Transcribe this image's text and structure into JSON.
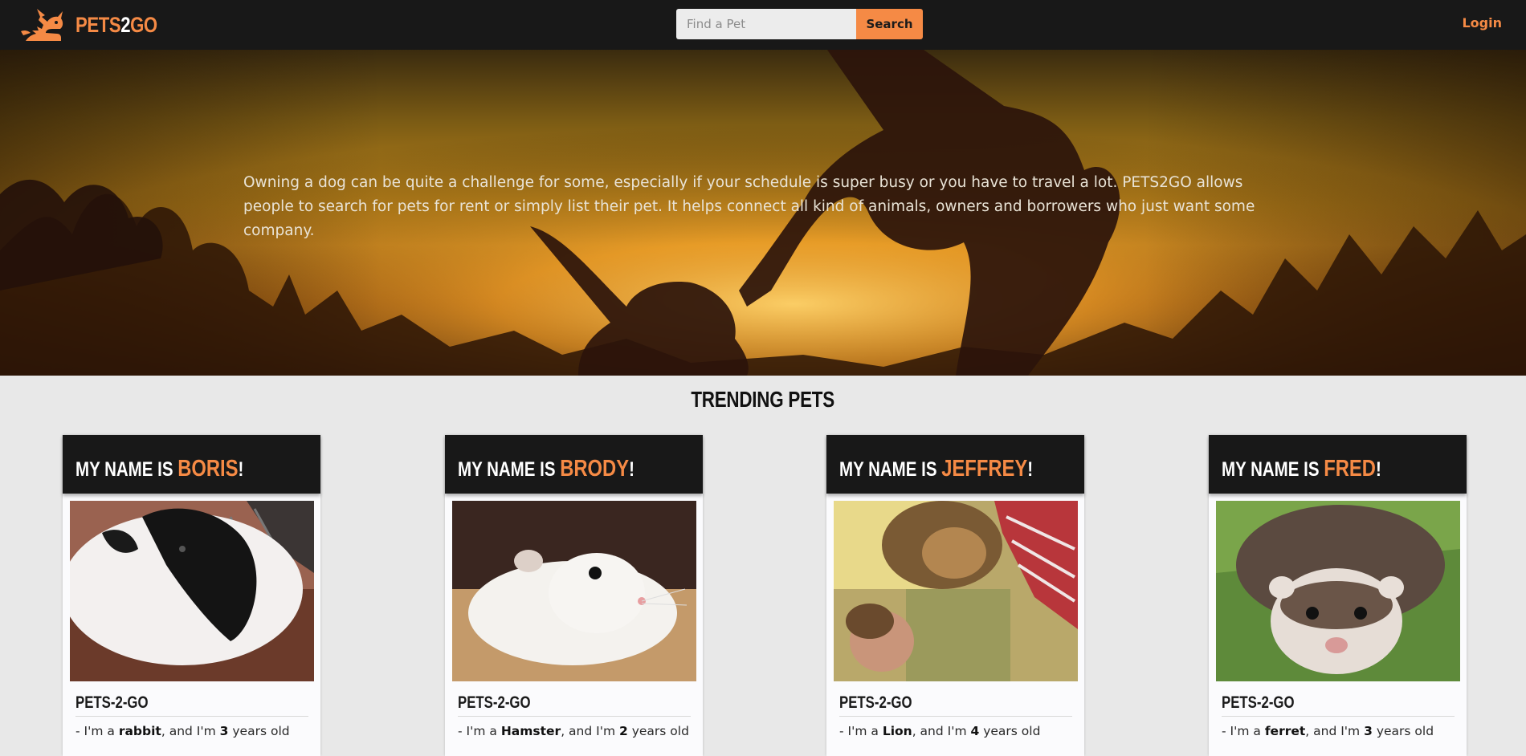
{
  "navbar": {
    "logo_text_a": "PETS",
    "logo_text_b": "2",
    "logo_text_c": "GO",
    "search_placeholder": "Find a Pet",
    "search_value": "",
    "search_button": "Search",
    "login": "Login"
  },
  "hero": {
    "text": "Owning a dog can be quite a challenge for some, especially if your schedule is super busy or you have to travel a lot. PETS2GO allows people to search for pets for rent or simply list their pet. It helps connect all kind of animals, owners and borrowers who just want some company."
  },
  "trending": {
    "title": "TRENDING PETS",
    "prefix": "MY NAME IS ",
    "suffix": "!",
    "brand": "PETS-2-GO",
    "desc_1": "- I'm a ",
    "desc_2": ", and I'm ",
    "desc_3": " years old",
    "pets": [
      {
        "name": "BORIS",
        "species": "rabbit",
        "age": "3"
      },
      {
        "name": "BRODY",
        "species": "Hamster",
        "age": "2"
      },
      {
        "name": "JEFFREY",
        "species": "Lion",
        "age": "4"
      },
      {
        "name": "FRED",
        "species": "ferret",
        "age": "3"
      }
    ]
  },
  "colors": {
    "accent": "#f58a45",
    "navbar": "#181818",
    "page_bg": "#e8e8e8"
  }
}
